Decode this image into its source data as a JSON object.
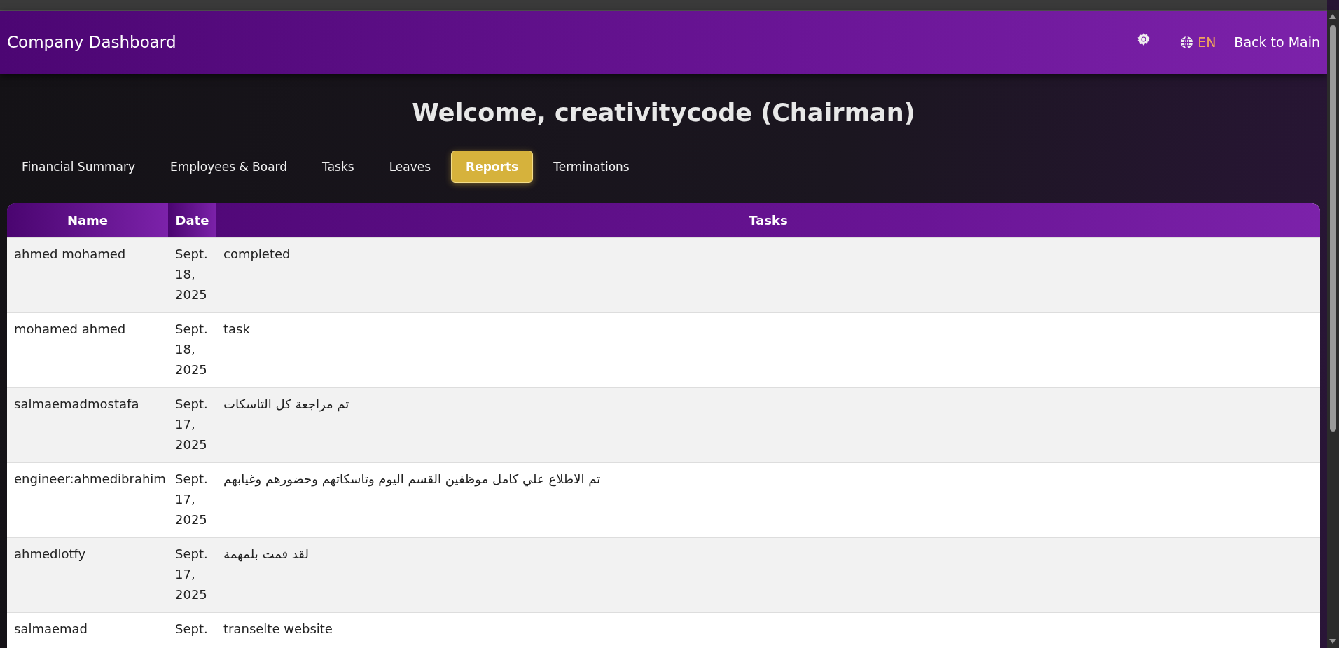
{
  "header": {
    "title": "Company Dashboard",
    "language": "EN",
    "back_link": "Back to Main"
  },
  "welcome": "Welcome, creativitycode (Chairman)",
  "tabs": [
    {
      "label": "Financial Summary",
      "selected": false
    },
    {
      "label": "Employees & Board",
      "selected": false
    },
    {
      "label": "Tasks",
      "selected": false
    },
    {
      "label": "Leaves",
      "selected": false
    },
    {
      "label": "Reports",
      "selected": true
    },
    {
      "label": "Terminations",
      "selected": false
    }
  ],
  "table": {
    "columns": [
      "Name",
      "Date",
      "Tasks"
    ],
    "rows": [
      {
        "name": "ahmed mohamed",
        "date": "Sept. 18, 2025",
        "tasks": "completed"
      },
      {
        "name": "mohamed ahmed",
        "date": "Sept. 18, 2025",
        "tasks": "task"
      },
      {
        "name": "salmaemadmostafa",
        "date": "Sept. 17, 2025",
        "tasks": "تم مراجعة كل التاسكات"
      },
      {
        "name": "engineer:ahmedibrahim",
        "date": "Sept. 17, 2025",
        "tasks": "تم الاطلاع علي كامل موظفين القسم اليوم وتاسكاتهم وحضورهم وغيابهم"
      },
      {
        "name": "ahmedlotfy",
        "date": "Sept. 17, 2025",
        "tasks": "لقد قمت بلمهمة"
      },
      {
        "name": "salmaemad",
        "date": "Sept.",
        "tasks": "transelte website"
      }
    ]
  }
}
